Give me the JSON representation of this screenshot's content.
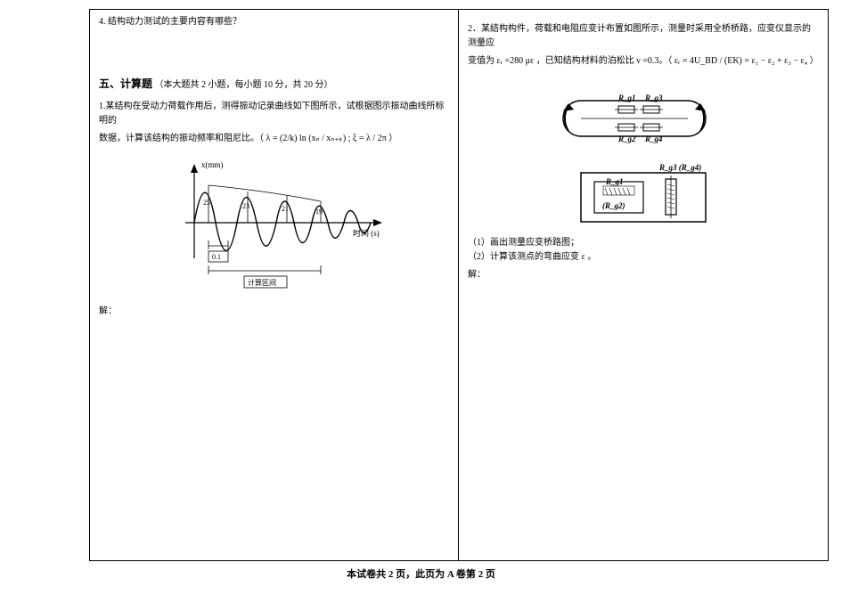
{
  "left": {
    "q4": "4. 结构动力测试的主要内容有哪些？",
    "section5_title": "五、计算题",
    "section5_note": "（本大题共 2 小题，每小题 10 分，共 20 分）",
    "q1_line1": "1.某结构在受动力荷载作用后，测得振动记录曲线如下图所示，试根据图示振动曲线所标明的",
    "q1_line2": "数据，计算该结构的振动频率和阻尼比。（ λ = (2/k) ln (xₙ / xₙ₊ₖ) ; ξ = λ / 2π ）",
    "q1_solve": "解：",
    "chart": {
      "y_label": "x(mm)",
      "x_label": "时间 (s)",
      "peaks": [
        "25",
        "23",
        "21",
        "19"
      ],
      "dt": "0.1",
      "span_label": "计算区间"
    }
  },
  "right": {
    "q2_line1": "2．某结构构件，荷载和电阻应变计布置如图所示，测量时采用全桥桥路，应变仪显示的测量应",
    "q2_line2": "变值为 εᵣ =280 με ，已知结构材料的泊松比 ν =0.3。（ εᵣ = 4U_BD / (EK) = ε₁ − ε₂ + ε₃ − ε₄ ）",
    "gauges": {
      "g1": "R_g1",
      "g2": "R_g2",
      "g3": "R_g3",
      "g4": "R_g4",
      "box_top": "R_g1",
      "box_bot": "(R_g2)",
      "box_right": "R_g3 (R_g4)"
    },
    "sub1": "（1）画出测量应变桥路图；",
    "sub2": "（2）计算该测点的弯曲应变 ε 。",
    "solve": "解："
  },
  "footer": "本试卷共 2 页，此页为 A 卷第 2 页"
}
